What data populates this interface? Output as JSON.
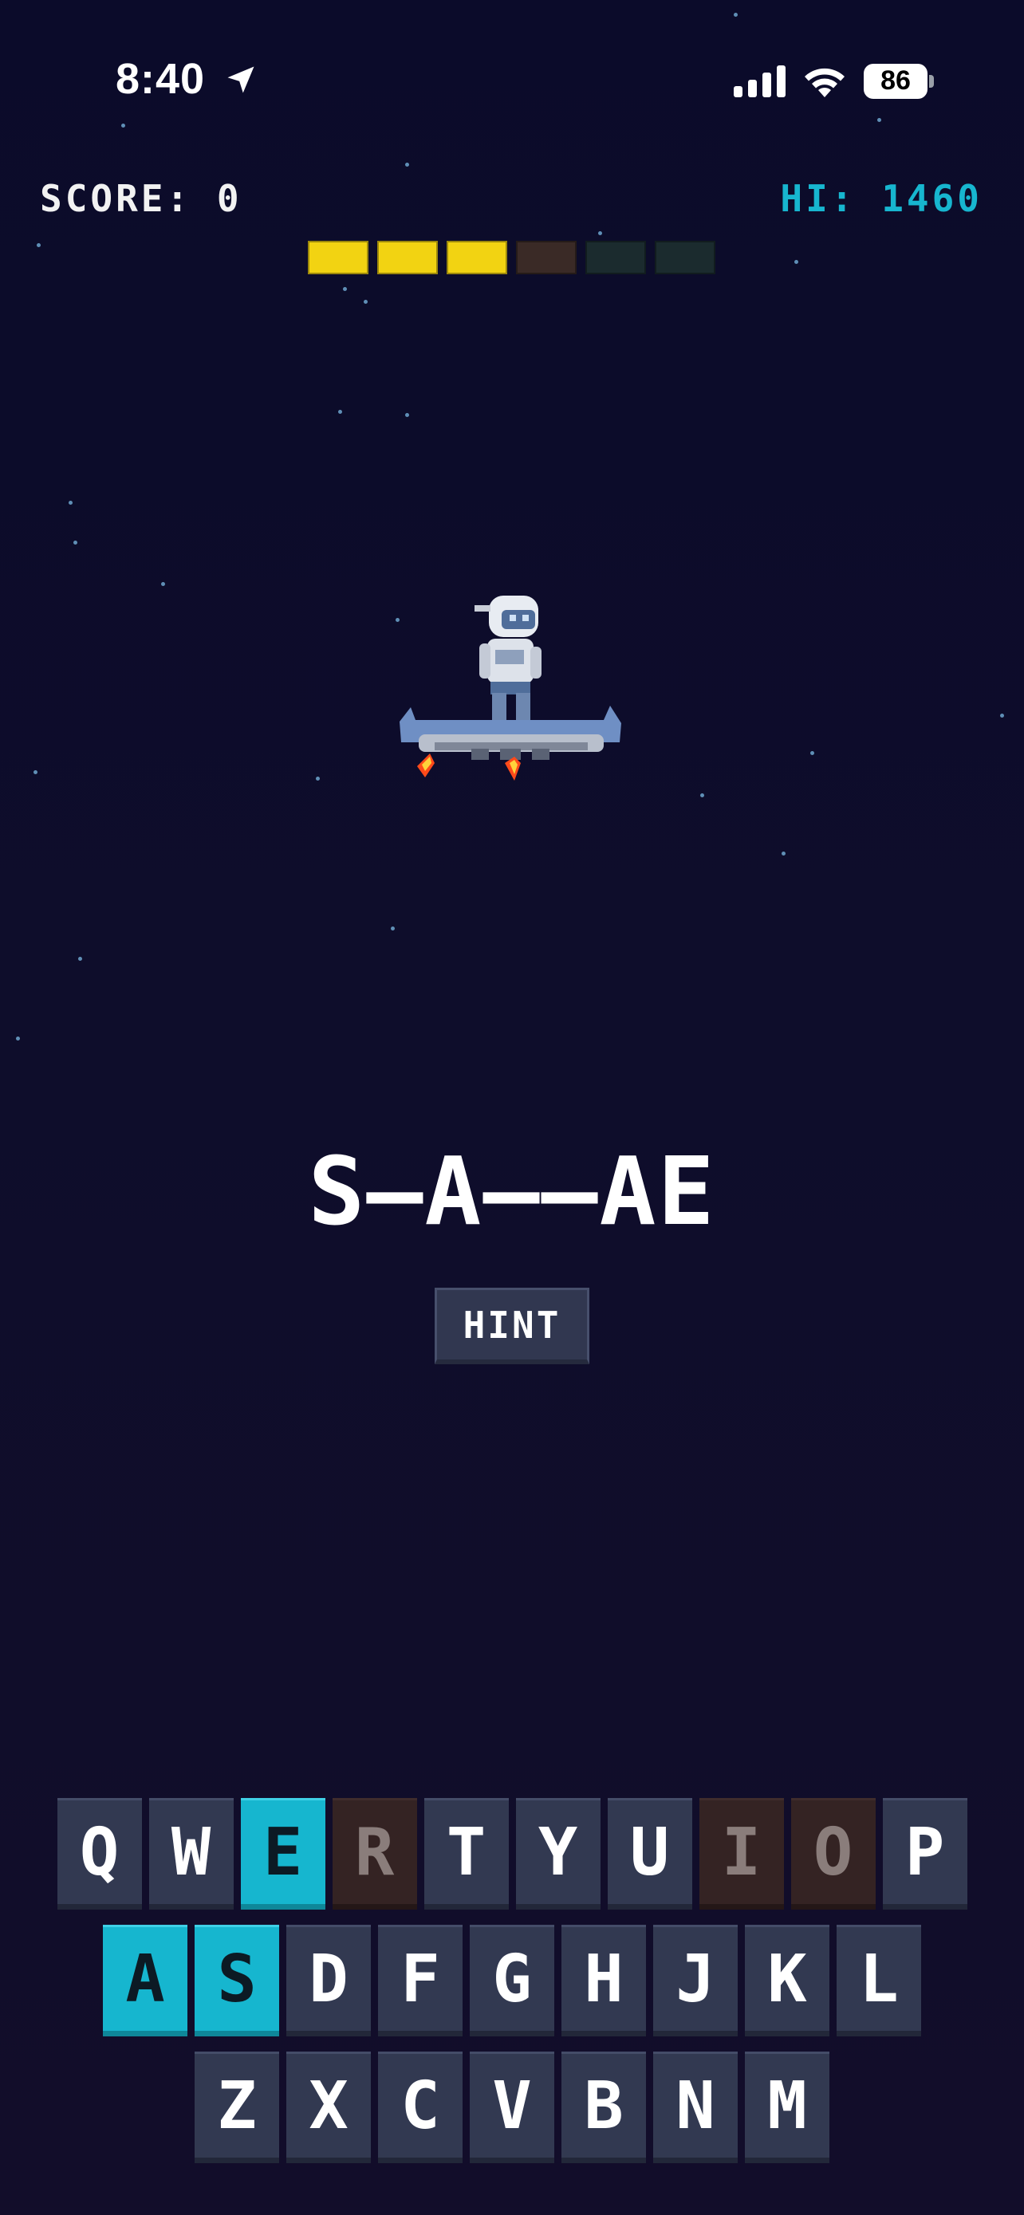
{
  "status_bar": {
    "time": "8:40",
    "battery": "86"
  },
  "header": {
    "score_label": "SCORE:",
    "score_value": "0",
    "hi_label": "HI:",
    "hi_value": "1460"
  },
  "lives": {
    "total": 6,
    "remaining": 3,
    "colors": {
      "full": "#f2d312",
      "lost_recent": "#3a2a26",
      "lost": "#1b2b2e"
    }
  },
  "word": {
    "display": "S—A——AE"
  },
  "hint": {
    "label": "HINT"
  },
  "keyboard": {
    "rows": [
      [
        {
          "letter": "Q",
          "state": "unused"
        },
        {
          "letter": "W",
          "state": "unused"
        },
        {
          "letter": "E",
          "state": "hit"
        },
        {
          "letter": "R",
          "state": "miss"
        },
        {
          "letter": "T",
          "state": "unused"
        },
        {
          "letter": "Y",
          "state": "unused"
        },
        {
          "letter": "U",
          "state": "unused"
        },
        {
          "letter": "I",
          "state": "miss"
        },
        {
          "letter": "O",
          "state": "miss"
        },
        {
          "letter": "P",
          "state": "unused"
        }
      ],
      [
        {
          "letter": "A",
          "state": "hit"
        },
        {
          "letter": "S",
          "state": "hit"
        },
        {
          "letter": "D",
          "state": "unused"
        },
        {
          "letter": "F",
          "state": "unused"
        },
        {
          "letter": "G",
          "state": "unused"
        },
        {
          "letter": "H",
          "state": "unused"
        },
        {
          "letter": "J",
          "state": "unused"
        },
        {
          "letter": "K",
          "state": "unused"
        },
        {
          "letter": "L",
          "state": "unused"
        }
      ],
      [
        {
          "letter": "Z",
          "state": "unused"
        },
        {
          "letter": "X",
          "state": "unused"
        },
        {
          "letter": "C",
          "state": "unused"
        },
        {
          "letter": "V",
          "state": "unused"
        },
        {
          "letter": "B",
          "state": "unused"
        },
        {
          "letter": "N",
          "state": "unused"
        },
        {
          "letter": "M",
          "state": "unused"
        }
      ]
    ],
    "colors": {
      "unused": "#323951",
      "hit": "#16b6cf",
      "miss": "#342323"
    }
  },
  "colors": {
    "background": "#0e0d2b",
    "hi_score": "#17b6cf",
    "star": "#6fa7cf"
  },
  "icons": [
    "location-arrow-icon",
    "cellular-signal-icon",
    "wifi-icon",
    "battery-icon",
    "astronaut-hoverboard-sprite"
  ]
}
